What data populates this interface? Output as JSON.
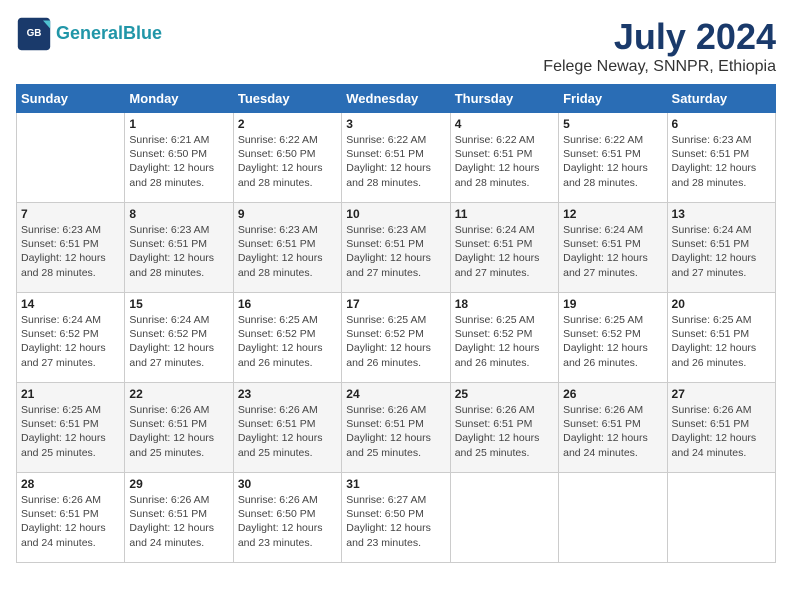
{
  "logo": {
    "line1": "General",
    "line2": "Blue"
  },
  "title": "July 2024",
  "subtitle": "Felege Neway, SNNPR, Ethiopia",
  "days_header": [
    "Sunday",
    "Monday",
    "Tuesday",
    "Wednesday",
    "Thursday",
    "Friday",
    "Saturday"
  ],
  "weeks": [
    [
      {
        "num": "",
        "info": ""
      },
      {
        "num": "1",
        "info": "Sunrise: 6:21 AM\nSunset: 6:50 PM\nDaylight: 12 hours\nand 28 minutes."
      },
      {
        "num": "2",
        "info": "Sunrise: 6:22 AM\nSunset: 6:50 PM\nDaylight: 12 hours\nand 28 minutes."
      },
      {
        "num": "3",
        "info": "Sunrise: 6:22 AM\nSunset: 6:51 PM\nDaylight: 12 hours\nand 28 minutes."
      },
      {
        "num": "4",
        "info": "Sunrise: 6:22 AM\nSunset: 6:51 PM\nDaylight: 12 hours\nand 28 minutes."
      },
      {
        "num": "5",
        "info": "Sunrise: 6:22 AM\nSunset: 6:51 PM\nDaylight: 12 hours\nand 28 minutes."
      },
      {
        "num": "6",
        "info": "Sunrise: 6:23 AM\nSunset: 6:51 PM\nDaylight: 12 hours\nand 28 minutes."
      }
    ],
    [
      {
        "num": "7",
        "info": "Sunrise: 6:23 AM\nSunset: 6:51 PM\nDaylight: 12 hours\nand 28 minutes."
      },
      {
        "num": "8",
        "info": "Sunrise: 6:23 AM\nSunset: 6:51 PM\nDaylight: 12 hours\nand 28 minutes."
      },
      {
        "num": "9",
        "info": "Sunrise: 6:23 AM\nSunset: 6:51 PM\nDaylight: 12 hours\nand 28 minutes."
      },
      {
        "num": "10",
        "info": "Sunrise: 6:23 AM\nSunset: 6:51 PM\nDaylight: 12 hours\nand 27 minutes."
      },
      {
        "num": "11",
        "info": "Sunrise: 6:24 AM\nSunset: 6:51 PM\nDaylight: 12 hours\nand 27 minutes."
      },
      {
        "num": "12",
        "info": "Sunrise: 6:24 AM\nSunset: 6:51 PM\nDaylight: 12 hours\nand 27 minutes."
      },
      {
        "num": "13",
        "info": "Sunrise: 6:24 AM\nSunset: 6:51 PM\nDaylight: 12 hours\nand 27 minutes."
      }
    ],
    [
      {
        "num": "14",
        "info": "Sunrise: 6:24 AM\nSunset: 6:52 PM\nDaylight: 12 hours\nand 27 minutes."
      },
      {
        "num": "15",
        "info": "Sunrise: 6:24 AM\nSunset: 6:52 PM\nDaylight: 12 hours\nand 27 minutes."
      },
      {
        "num": "16",
        "info": "Sunrise: 6:25 AM\nSunset: 6:52 PM\nDaylight: 12 hours\nand 26 minutes."
      },
      {
        "num": "17",
        "info": "Sunrise: 6:25 AM\nSunset: 6:52 PM\nDaylight: 12 hours\nand 26 minutes."
      },
      {
        "num": "18",
        "info": "Sunrise: 6:25 AM\nSunset: 6:52 PM\nDaylight: 12 hours\nand 26 minutes."
      },
      {
        "num": "19",
        "info": "Sunrise: 6:25 AM\nSunset: 6:52 PM\nDaylight: 12 hours\nand 26 minutes."
      },
      {
        "num": "20",
        "info": "Sunrise: 6:25 AM\nSunset: 6:51 PM\nDaylight: 12 hours\nand 26 minutes."
      }
    ],
    [
      {
        "num": "21",
        "info": "Sunrise: 6:25 AM\nSunset: 6:51 PM\nDaylight: 12 hours\nand 25 minutes."
      },
      {
        "num": "22",
        "info": "Sunrise: 6:26 AM\nSunset: 6:51 PM\nDaylight: 12 hours\nand 25 minutes."
      },
      {
        "num": "23",
        "info": "Sunrise: 6:26 AM\nSunset: 6:51 PM\nDaylight: 12 hours\nand 25 minutes."
      },
      {
        "num": "24",
        "info": "Sunrise: 6:26 AM\nSunset: 6:51 PM\nDaylight: 12 hours\nand 25 minutes."
      },
      {
        "num": "25",
        "info": "Sunrise: 6:26 AM\nSunset: 6:51 PM\nDaylight: 12 hours\nand 25 minutes."
      },
      {
        "num": "26",
        "info": "Sunrise: 6:26 AM\nSunset: 6:51 PM\nDaylight: 12 hours\nand 24 minutes."
      },
      {
        "num": "27",
        "info": "Sunrise: 6:26 AM\nSunset: 6:51 PM\nDaylight: 12 hours\nand 24 minutes."
      }
    ],
    [
      {
        "num": "28",
        "info": "Sunrise: 6:26 AM\nSunset: 6:51 PM\nDaylight: 12 hours\nand 24 minutes."
      },
      {
        "num": "29",
        "info": "Sunrise: 6:26 AM\nSunset: 6:51 PM\nDaylight: 12 hours\nand 24 minutes."
      },
      {
        "num": "30",
        "info": "Sunrise: 6:26 AM\nSunset: 6:50 PM\nDaylight: 12 hours\nand 23 minutes."
      },
      {
        "num": "31",
        "info": "Sunrise: 6:27 AM\nSunset: 6:50 PM\nDaylight: 12 hours\nand 23 minutes."
      },
      {
        "num": "",
        "info": ""
      },
      {
        "num": "",
        "info": ""
      },
      {
        "num": "",
        "info": ""
      }
    ]
  ]
}
